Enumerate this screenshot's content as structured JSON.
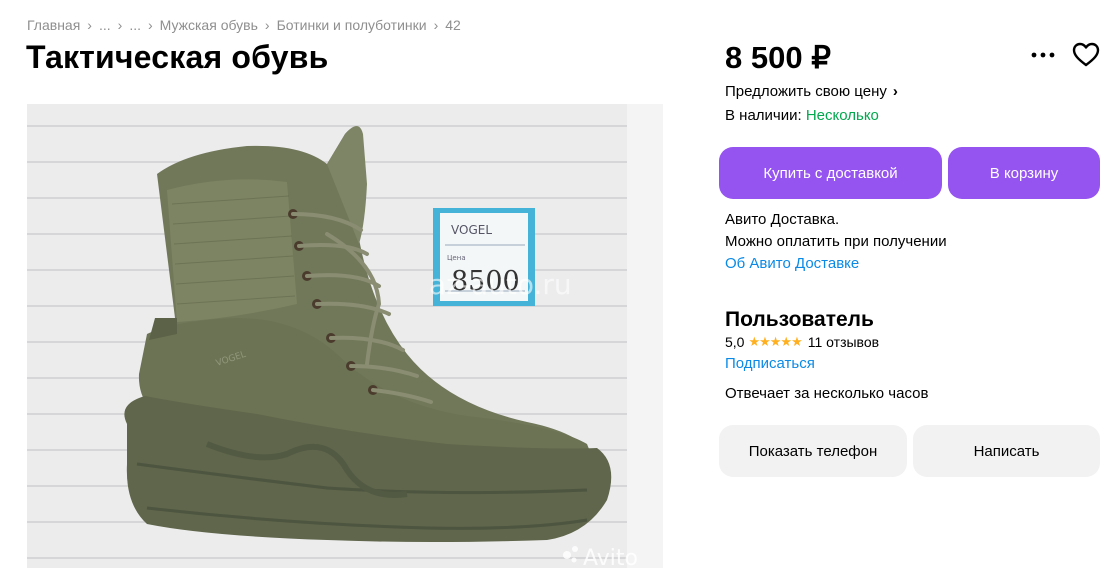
{
  "breadcrumb": {
    "items": [
      "Главная",
      "...",
      "...",
      "Мужская обувь",
      "Ботинки и полуботинки",
      "42"
    ]
  },
  "listing": {
    "title": "Тактическая обувь",
    "price": "8 500 ₽",
    "offer_price_label": "Предложить свою цену",
    "availability_label": "В наличии:",
    "availability_value": "Несколько"
  },
  "photo": {
    "tag_brand": "VOGEL",
    "tag_small": "Цена",
    "tag_price": "8500",
    "boot_logo": "VOGEL",
    "watermark_site": "az-auto.ru",
    "watermark_avito": "Avito"
  },
  "actions": {
    "buy_delivery_label": "Купить с доставкой",
    "cart_label": "В корзину",
    "phone_label": "Показать телефон",
    "write_label": "Написать"
  },
  "delivery": {
    "line1": "Авито Доставка.",
    "line2": "Можно оплатить при получении",
    "link": "Об Авито Доставке"
  },
  "seller": {
    "name": "Пользователь",
    "rating": "5,0",
    "stars": "★★★★★",
    "reviews": "11 отзывов",
    "subscribe": "Подписаться",
    "response": "Отвечает за несколько часов"
  },
  "icons": {
    "more": "more-dots-icon",
    "favorite": "heart-icon"
  },
  "colors": {
    "accent": "#9553f0",
    "link": "#0a8ae6",
    "in_stock": "#02a84e",
    "stars": "#ffb021"
  }
}
